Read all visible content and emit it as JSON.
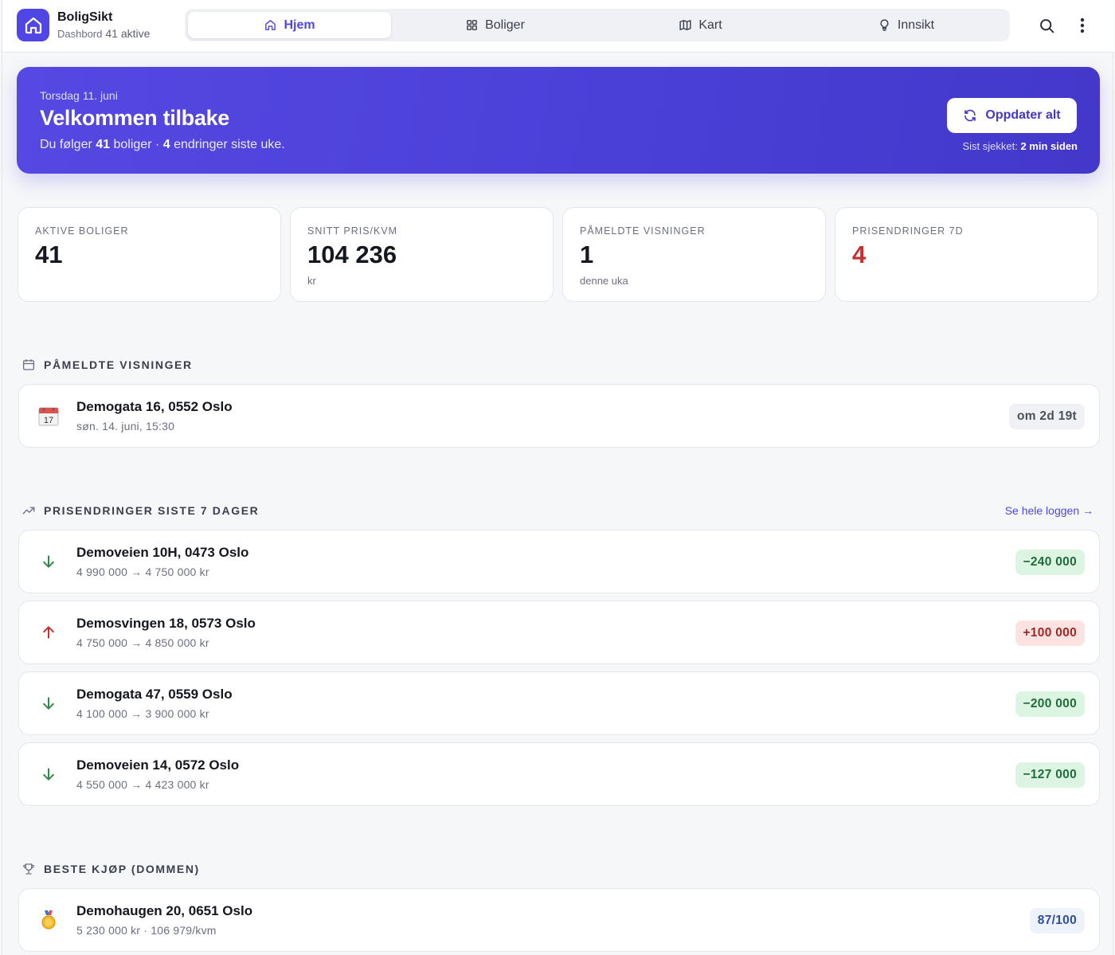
{
  "app": {
    "name": "BoligSikt",
    "subtitle": "Dashbord",
    "active_count": "41 aktive"
  },
  "nav": {
    "tabs": [
      {
        "label": "Hjem",
        "icon": "home-icon",
        "active": true
      },
      {
        "label": "Boliger",
        "icon": "grid-icon",
        "active": false
      },
      {
        "label": "Kart",
        "icon": "map-icon",
        "active": false
      },
      {
        "label": "Innsikt",
        "icon": "lightbulb-icon",
        "active": false
      }
    ],
    "search_icon": "search-icon",
    "menu_icon": "more-vertical-icon"
  },
  "hero": {
    "date": "Torsdag 11. juni",
    "title": "Velkommen tilbake",
    "sub_prefix": "Du følger ",
    "followed": "41",
    "sub_middle": " boliger · ",
    "changes": "4",
    "sub_suffix": " endringer siste uke.",
    "refresh_label": "Oppdater alt",
    "last_checked_label": "Sist sjekket: ",
    "last_checked_value": "2 min siden"
  },
  "stats": [
    {
      "label": "AKTIVE BOLIGER",
      "value": "41",
      "unit": ""
    },
    {
      "label": "SNITT PRIS/KVM",
      "value": "104 236",
      "unit": "kr"
    },
    {
      "label": "PÅMELDTE VISNINGER",
      "value": "1",
      "unit": "denne uka"
    },
    {
      "label": "PRISENDRINGER 7D",
      "value": "4",
      "unit": ""
    }
  ],
  "viewings": {
    "heading": "PÅMELDTE VISNINGER",
    "items": [
      {
        "address": "Demogata 16, 0552 Oslo",
        "time": "søn. 14. juni, 15:30",
        "badge": "om 2d 19t",
        "calendar_day": "17"
      }
    ]
  },
  "price_changes": {
    "heading": "PRISENDRINGER SISTE 7 DAGER",
    "link": "Se hele loggen →",
    "items": [
      {
        "address": "Demoveien 10H, 0473 Oslo",
        "change": "4 990 000 → 4 750 000 kr",
        "delta": "−240 000",
        "direction": "down"
      },
      {
        "address": "Demosvingen 18, 0573 Oslo",
        "change": "4 750 000 → 4 850 000 kr",
        "delta": "+100 000",
        "direction": "up"
      },
      {
        "address": "Demogata 47, 0559 Oslo",
        "change": "4 100 000 → 3 900 000 kr",
        "delta": "−200 000",
        "direction": "down"
      },
      {
        "address": "Demoveien 14, 0572 Oslo",
        "change": "4 550 000 → 4 423 000 kr",
        "delta": "−127 000",
        "direction": "down"
      }
    ]
  },
  "best_buys": {
    "heading": "BESTE KJØP (DOMMEN)",
    "items": [
      {
        "address": "Demohaugen 20, 0651 Oslo",
        "details": "5 230 000 kr · 106 979/kvm",
        "score": "87/100"
      }
    ]
  },
  "colors": {
    "accent": "#4f46e5",
    "down": "#2f8a48",
    "up": "#c53030"
  }
}
